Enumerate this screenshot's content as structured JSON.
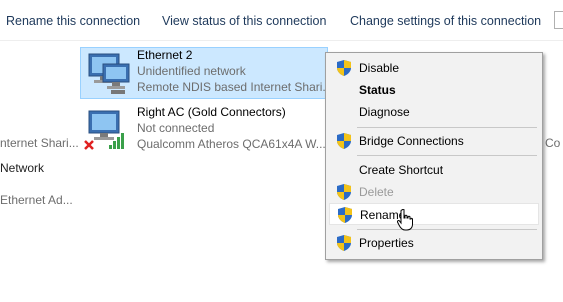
{
  "toolbar": {
    "items": [
      {
        "label": "Rename this connection"
      },
      {
        "label": "View status of this connection"
      },
      {
        "label": "Change settings of this connection"
      }
    ]
  },
  "connections": [
    {
      "name": "Ethernet 2",
      "status": "Unidentified network",
      "adapter": "Remote NDIS based Internet Shari...",
      "selected": true
    },
    {
      "name": "Right AC (Gold Connectors)",
      "status": "Not connected",
      "adapter": "Qualcomm Atheros QCA61x4A W..."
    }
  ],
  "left_partial": {
    "line1": "nternet Shari...",
    "line2": "Network",
    "line3": "Ethernet Ad..."
  },
  "right_partial": {
    "text": "Co"
  },
  "context_menu": {
    "items": [
      {
        "label": "Disable",
        "shield": true
      },
      {
        "label": "Status",
        "bold": true
      },
      {
        "label": "Diagnose"
      },
      {
        "label": "Bridge Connections",
        "shield": true
      },
      {
        "label": "Create Shortcut"
      },
      {
        "label": "Delete",
        "shield": true,
        "disabled": true
      },
      {
        "label": "Rename",
        "shield": true,
        "hovered": true
      },
      {
        "label": "Properties",
        "shield": true
      }
    ]
  },
  "colors": {
    "selection_bg": "#cce8ff",
    "selection_border": "#99d1ff",
    "toolbar_text": "#1e395b",
    "menu_bg": "#f2f2f2"
  }
}
